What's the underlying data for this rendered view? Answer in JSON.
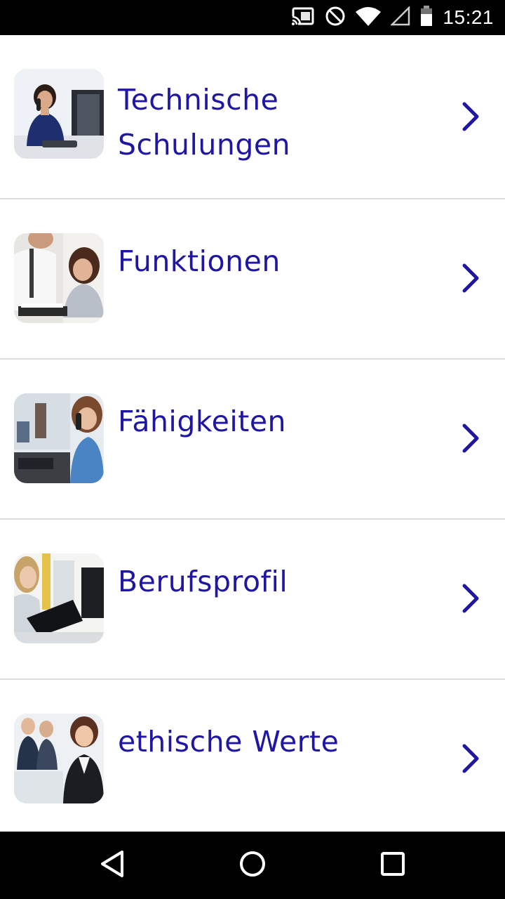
{
  "status_bar": {
    "time": "15:21",
    "icons": [
      "cast-icon",
      "do-not-disturb-icon",
      "wifi-icon",
      "cell-signal-icon",
      "battery-icon"
    ]
  },
  "menu": {
    "accent_color": "#1f17a3",
    "items": [
      {
        "label": "Technische Schulungen",
        "label_lines": [
          "Technische",
          "Schulungen"
        ],
        "thumbnail": "call-center-agent-photo"
      },
      {
        "label": "Funktionen",
        "thumbnail": "training-session-photo"
      },
      {
        "label": "Fähigkeiten",
        "thumbnail": "office-phone-photo"
      },
      {
        "label": "Berufsprofil",
        "thumbnail": "office-desk-photo"
      },
      {
        "label": "ethische Werte",
        "thumbnail": "business-team-photo"
      }
    ]
  },
  "nav_bar": {
    "buttons": [
      "back-icon",
      "home-icon",
      "recents-icon"
    ]
  }
}
